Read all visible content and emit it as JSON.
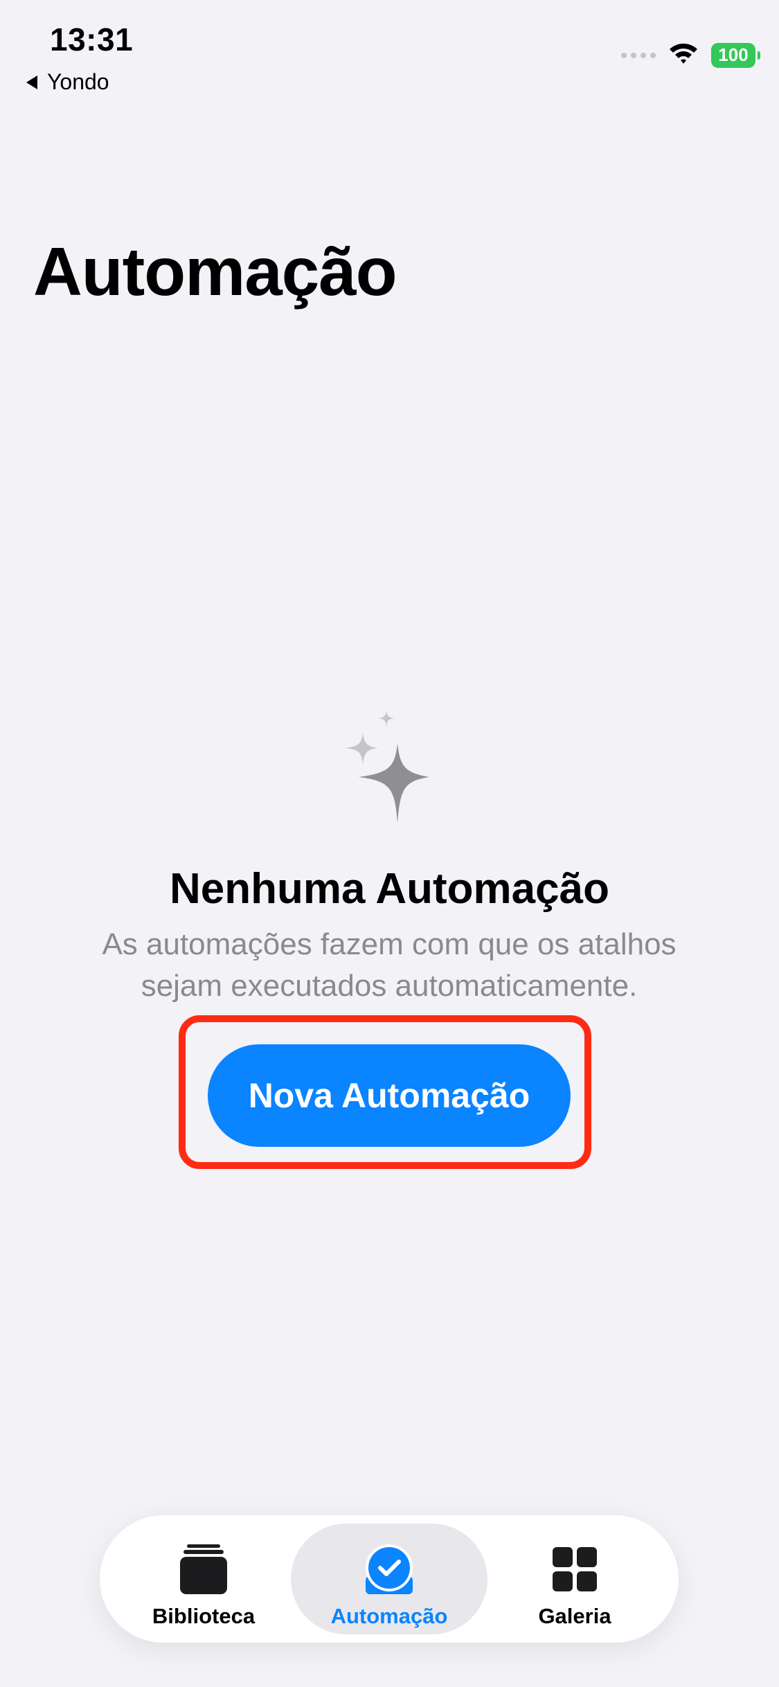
{
  "status_bar": {
    "time": "13:31",
    "back_app": "Yondo",
    "battery": "100"
  },
  "page": {
    "title": "Automação"
  },
  "empty_state": {
    "icon": "sparkles-icon",
    "title": "Nenhuma Automação",
    "description_line1": "As automações fazem com que os atalhos",
    "description_line2": "sejam executados automaticamente.",
    "button_label": "Nova Automação"
  },
  "tab_bar": {
    "items": [
      {
        "label": "Biblioteca",
        "icon": "library-icon",
        "active": false
      },
      {
        "label": "Automação",
        "icon": "automation-icon",
        "active": true
      },
      {
        "label": "Galeria",
        "icon": "gallery-icon",
        "active": false
      }
    ]
  },
  "colors": {
    "background": "#f2f2f7",
    "accent": "#0a84ff",
    "highlight": "#ff2a14",
    "battery": "#34c759",
    "secondary_text": "#8a8a8e"
  }
}
